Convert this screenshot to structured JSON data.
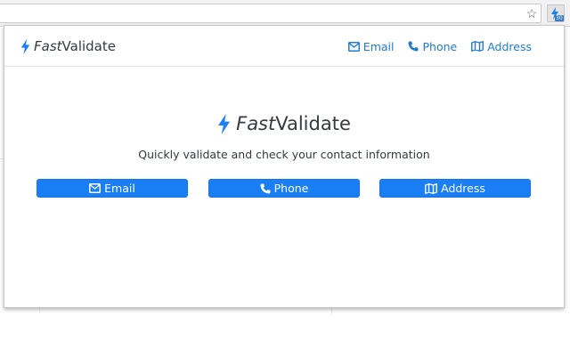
{
  "browser": {
    "star_icon": "star-icon",
    "extension_badge": "30"
  },
  "navbar": {
    "brand_fast": "Fast",
    "brand_validate": "Validate",
    "links": [
      {
        "label": "Email",
        "icon": "envelope-icon"
      },
      {
        "label": "Phone",
        "icon": "phone-icon"
      },
      {
        "label": "Address",
        "icon": "map-icon"
      }
    ]
  },
  "hero": {
    "brand_fast": "Fast",
    "brand_validate": "Validate",
    "subtitle": "Quickly validate and check your contact information"
  },
  "buttons": [
    {
      "label": "Email",
      "icon": "envelope-icon"
    },
    {
      "label": "Phone",
      "icon": "phone-icon"
    },
    {
      "label": "Address",
      "icon": "map-icon"
    }
  ],
  "colors": {
    "accent": "#1a7ff6",
    "link": "#1f7bd6",
    "bolt": "#1a7ff6",
    "text": "#343a40"
  }
}
